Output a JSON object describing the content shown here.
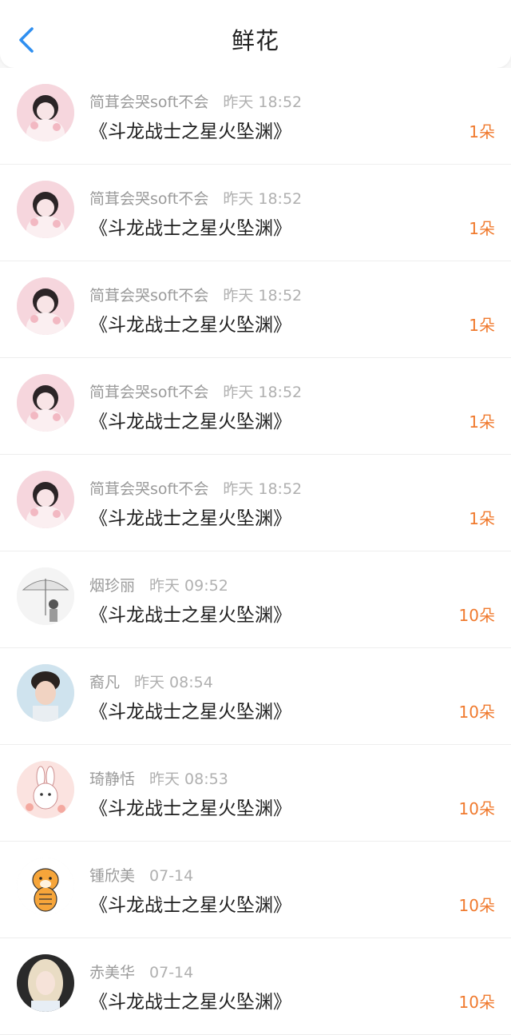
{
  "header": {
    "title": "鲜花",
    "back_icon": "chevron-left-icon",
    "accent": "#2f8ff0"
  },
  "colors": {
    "count": "#f07a2e"
  },
  "items": [
    {
      "name": "简茸会哭soft不会",
      "time": "昨天 18:52",
      "book": "《斗龙战士之星火坠渊》",
      "count": "1朵",
      "avatar": "pink-girl"
    },
    {
      "name": "简茸会哭soft不会",
      "time": "昨天 18:52",
      "book": "《斗龙战士之星火坠渊》",
      "count": "1朵",
      "avatar": "pink-girl"
    },
    {
      "name": "简茸会哭soft不会",
      "time": "昨天 18:52",
      "book": "《斗龙战士之星火坠渊》",
      "count": "1朵",
      "avatar": "pink-girl"
    },
    {
      "name": "简茸会哭soft不会",
      "time": "昨天 18:52",
      "book": "《斗龙战士之星火坠渊》",
      "count": "1朵",
      "avatar": "pink-girl"
    },
    {
      "name": "简茸会哭soft不会",
      "time": "昨天 18:52",
      "book": "《斗龙战士之星火坠渊》",
      "count": "1朵",
      "avatar": "pink-girl"
    },
    {
      "name": "烟珍丽",
      "time": "昨天 09:52",
      "book": "《斗龙战士之星火坠渊》",
      "count": "10朵",
      "avatar": "umbrella-sketch"
    },
    {
      "name": "裔凡",
      "time": "昨天 08:54",
      "book": "《斗龙战士之星火坠渊》",
      "count": "10朵",
      "avatar": "boy-portrait"
    },
    {
      "name": "琦静恬",
      "time": "昨天 08:53",
      "book": "《斗龙战士之星火坠渊》",
      "count": "10朵",
      "avatar": "bunny"
    },
    {
      "name": "锺欣美",
      "time": "07-14",
      "book": "《斗龙战士之星火坠渊》",
      "count": "10朵",
      "avatar": "tiger"
    },
    {
      "name": "赤美华",
      "time": "07-14",
      "book": "《斗龙战士之星火坠渊》",
      "count": "10朵",
      "avatar": "blonde-girl"
    }
  ]
}
